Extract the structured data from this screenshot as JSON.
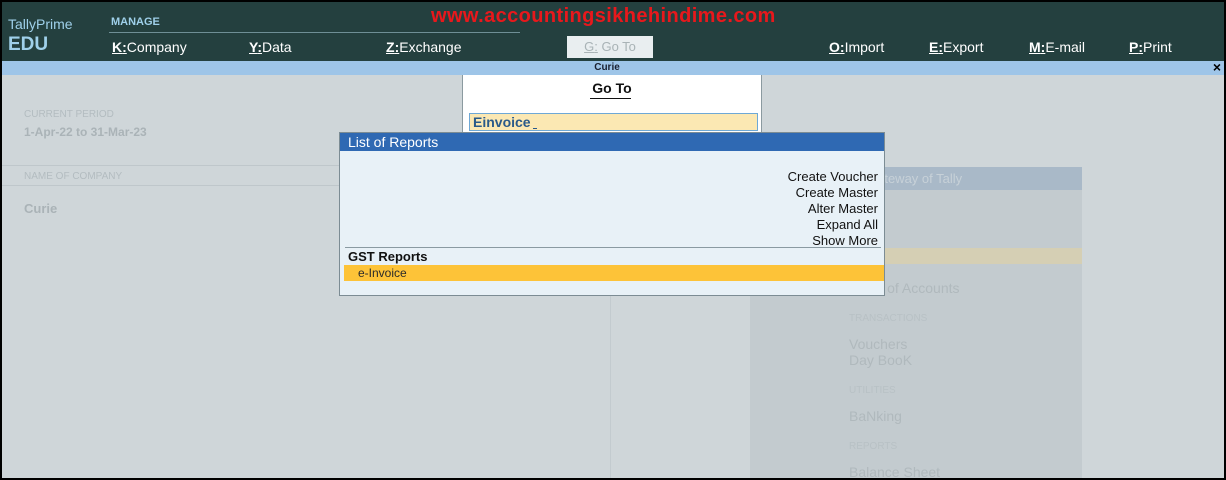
{
  "brand": {
    "product": "TallyPrime",
    "edition": "EDU"
  },
  "watermark": "www.accountingsikhehindime.com",
  "topbar": {
    "section": "MANAGE",
    "menu": [
      {
        "key": "K",
        "label": "Company"
      },
      {
        "key": "Y",
        "label": "Data"
      },
      {
        "key": "Z",
        "label": "Exchange"
      },
      {
        "key": "G",
        "label": "Go To"
      },
      {
        "key": "O",
        "label": "Import"
      },
      {
        "key": "E",
        "label": "Export"
      },
      {
        "key": "M",
        "label": "E-mail"
      },
      {
        "key": "P",
        "label": "Print"
      }
    ]
  },
  "company_strip": {
    "title": "Curie",
    "close": "×"
  },
  "background": {
    "current_period_label": "CURRENT PERIOD",
    "current_period_value": "1-Apr-22 to 31-Mar-23",
    "company_label": "NAME OF COMPANY",
    "company_value": "Curie",
    "gateway_title": "Gateway of Tally",
    "items": {
      "chart_of_accounts": "Chart of Accounts",
      "transactions": "TRANSACTIONS",
      "vouchers": "Vouchers",
      "daybook": "Day BooK",
      "utilities": "UTILITIES",
      "banking": "BaNking",
      "reports": "REPORTS",
      "balance_sheet": "Balance Sheet"
    }
  },
  "goto": {
    "title": "Go To",
    "input_value": "Einvoice"
  },
  "list_of_reports": {
    "title": "List of Reports",
    "actions": [
      "Create Voucher",
      "Create Master",
      "Alter Master",
      "Expand All",
      "Show More"
    ],
    "group": "GST Reports",
    "selected_item": "e-Invoice"
  },
  "colors": {
    "topbar_bg": "#24403f",
    "accent_blue": "#2f69b3",
    "selection_yellow": "#fdc338",
    "watermark_red": "#e8181c"
  }
}
